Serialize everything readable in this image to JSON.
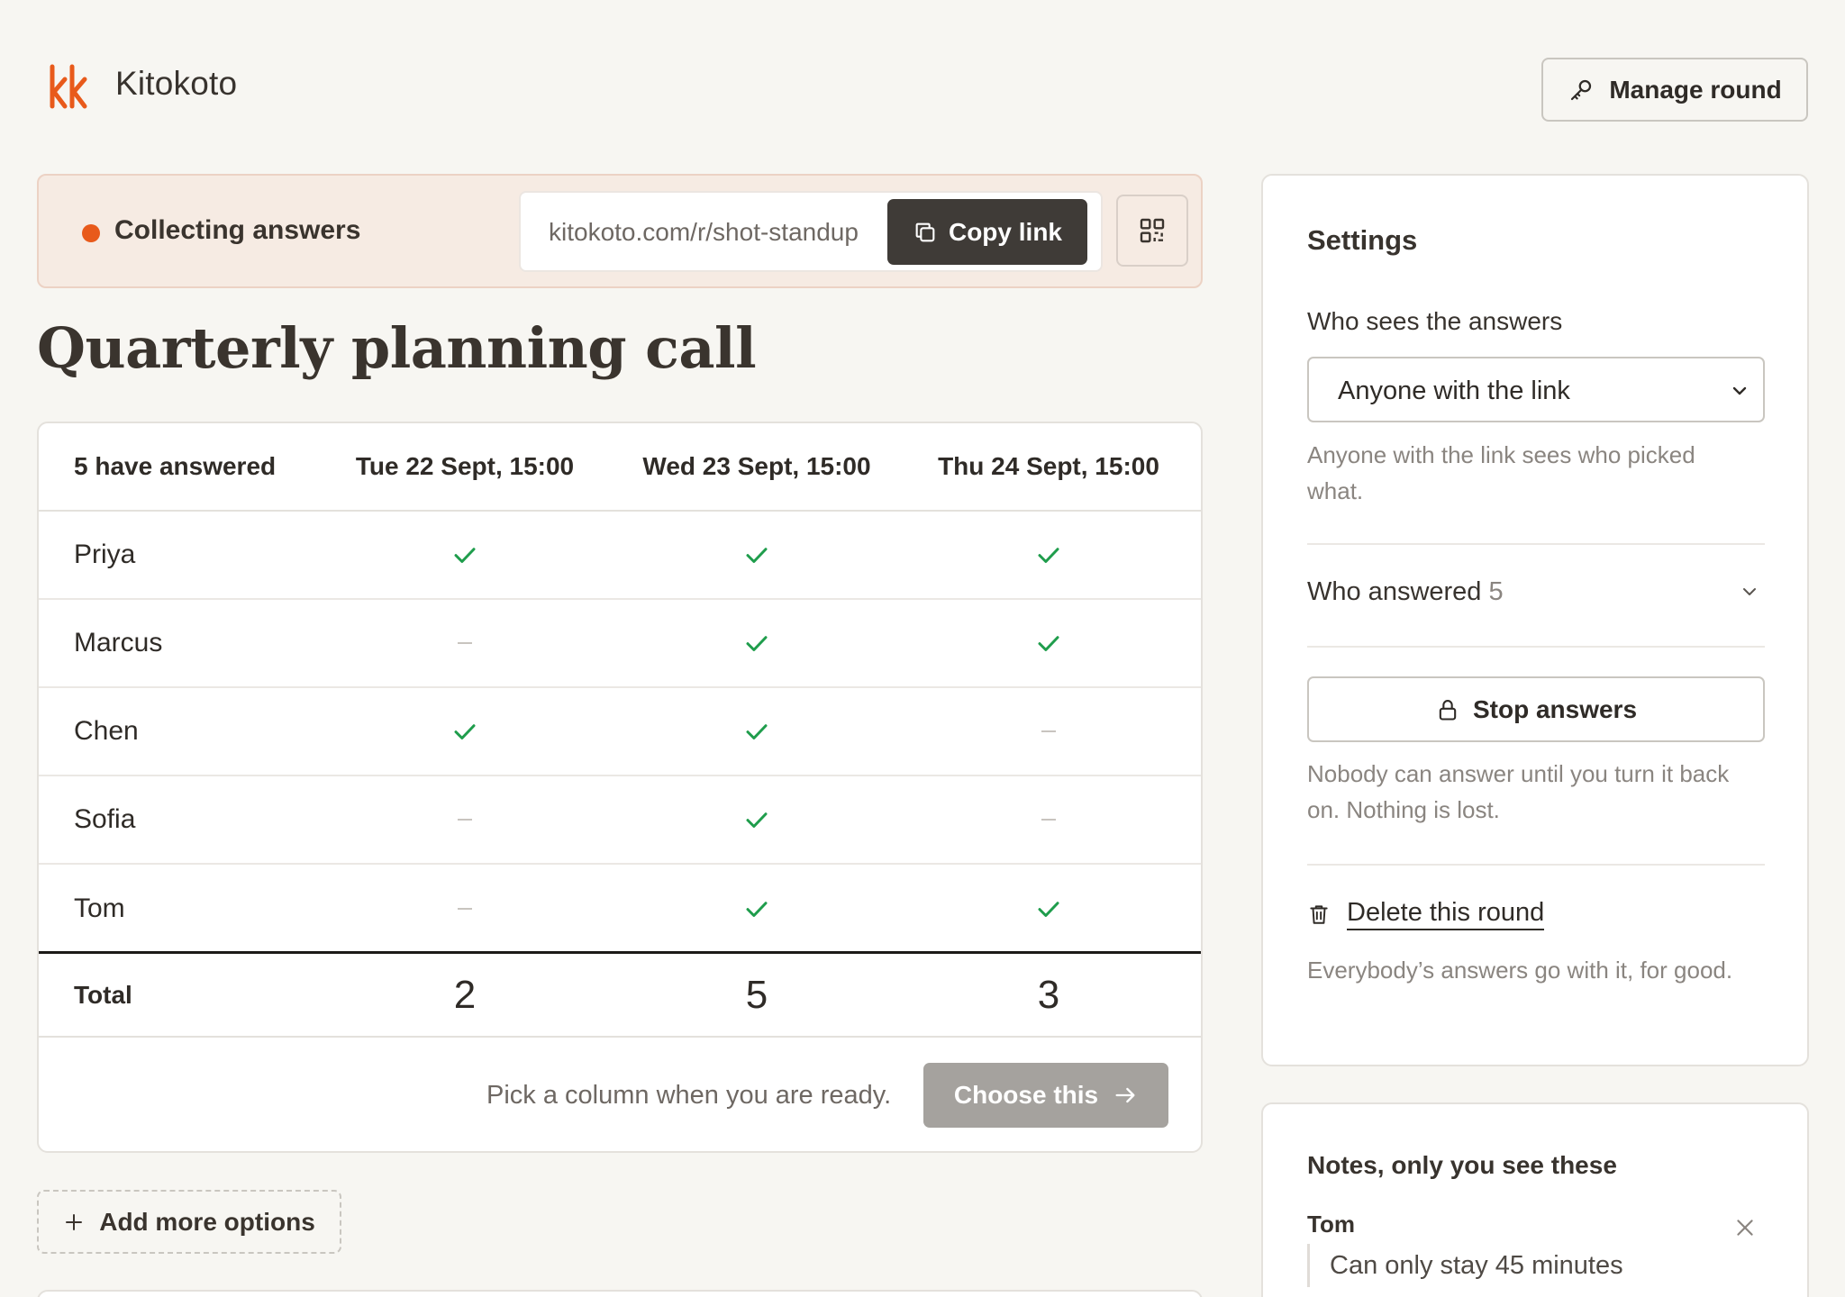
{
  "header": {
    "brand": "Kitokoto",
    "manage_label": "Manage round"
  },
  "status": {
    "text": "Collecting answers",
    "link": "kitokoto.com/r/shot-standup",
    "copy_label": "Copy link",
    "dot_color": "#e85a1b"
  },
  "title": "Quarterly planning call",
  "table": {
    "answered_header": "5 have answered",
    "columns": [
      "Tue 22 Sept, 15:00",
      "Wed 23 Sept, 15:00",
      "Thu 24 Sept, 15:00"
    ],
    "rows": [
      {
        "name": "Priya",
        "marks": [
          true,
          true,
          true
        ]
      },
      {
        "name": "Marcus",
        "marks": [
          false,
          true,
          true
        ]
      },
      {
        "name": "Chen",
        "marks": [
          true,
          true,
          false
        ]
      },
      {
        "name": "Sofia",
        "marks": [
          false,
          true,
          false
        ]
      },
      {
        "name": "Tom",
        "marks": [
          false,
          true,
          true
        ]
      }
    ],
    "total_label": "Total",
    "totals": [
      "2",
      "5",
      "3"
    ],
    "footer_hint": "Pick a column when you are ready.",
    "choose_label": "Choose this",
    "check_color": "#1f9d4c"
  },
  "add_options_label": "Add more options",
  "settings": {
    "title": "Settings",
    "visibility_label": "Who sees the answers",
    "visibility_value": "Anyone with the link",
    "visibility_help": "Anyone with the link sees who picked what.",
    "answered_label": "Who answered",
    "answered_count": "5",
    "stop_label": "Stop answers",
    "stop_help": "Nobody can answer until you turn it back on. Nothing is lost.",
    "delete_label": "Delete this round",
    "delete_help": "Everybody’s answers go with it, for good."
  },
  "notes": {
    "title": "Notes, only you see these",
    "items": [
      {
        "name": "Tom",
        "text": "Can only stay 45 minutes"
      }
    ]
  }
}
